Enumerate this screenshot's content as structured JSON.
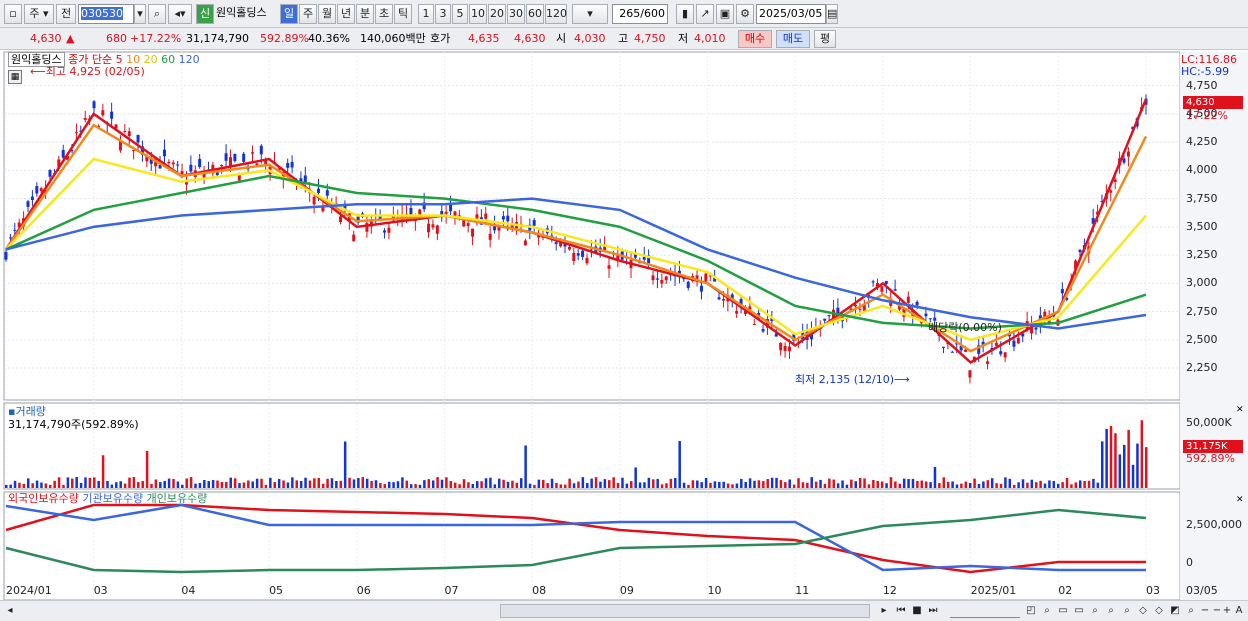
{
  "toolbar": {
    "market_label": "주",
    "prev_label": "전",
    "code_value": "030530",
    "badge_label": "신",
    "stock_name": "원익홀딩스",
    "periods": [
      "일",
      "주",
      "월",
      "년",
      "분",
      "초",
      "틱"
    ],
    "active_period": "일",
    "interval_numbers": [
      "1",
      "3",
      "5",
      "10",
      "20",
      "30",
      "60",
      "120"
    ],
    "count_value": "265",
    "count_total": "/600",
    "date_value": "2025/03/05"
  },
  "quote": {
    "price": "4,630",
    "change_arrow": "▲",
    "change": "680",
    "change_pct": "+17.22%",
    "volume": "31,174,790",
    "volume_ratio": "592.89%",
    "turnover_pct": "40.36%",
    "amount": "140,060백만",
    "bid_label": "호가",
    "bid_value": "4,635",
    "ask_value": "4,630",
    "open_label": "시",
    "open_value": "4,030",
    "high_label": "고",
    "high_value": "4,750",
    "low_label": "저",
    "low_value": "4,010",
    "buy_label": "매수",
    "sell_label": "매도",
    "eval_label": "평"
  },
  "legend": {
    "stock_label": "원익홀딩스",
    "ma_label": "종가 단순",
    "ma_periods": [
      "5",
      "10",
      "20",
      "60",
      "120"
    ],
    "ma_colors": [
      "#e0101c",
      "#f08a1c",
      "#f8e81c",
      "#20a040",
      "#3a66e0"
    ],
    "high_annotation": "최고 4,925 (02/05)",
    "low_annotation": "최저 2,135 (12/10)",
    "dividend_annotation": "배당락(0.00%)",
    "lc_label": "LC:116.86",
    "hc_label": "HC:-5.99",
    "price_tag": "4,630",
    "pct_tag": "17.22%"
  },
  "volume_panel": {
    "title": "거래량",
    "value_text": "31,174,790주(592.89%)",
    "axis_label": "50,000K",
    "tag_value": "31,175K",
    "tag_pct": "592.89%"
  },
  "holdings_panel": {
    "foreign_label": "외국인보유수량",
    "institution_label": "기관보유수량",
    "individual_label": "개인보유수량",
    "axis_labels": [
      "2,500,000",
      "0"
    ]
  },
  "x_axis": {
    "labels": [
      "2024/01",
      "03",
      "04",
      "05",
      "06",
      "07",
      "08",
      "09",
      "10",
      "11",
      "12",
      "2025/01",
      "02",
      "03",
      "03/05"
    ]
  },
  "chart_data": {
    "type": "line",
    "title": "원익홀딩스",
    "y_ticks": [
      "4,750",
      "4,500",
      "4,250",
      "4,000",
      "3,750",
      "3,500",
      "3,250",
      "3,000",
      "2,750",
      "2,500",
      "2,250"
    ],
    "ylim": [
      2100,
      4800
    ],
    "x": [
      "2024/01",
      "03",
      "04",
      "05",
      "06",
      "07",
      "08",
      "09",
      "10",
      "11",
      "12",
      "2025/01",
      "02",
      "03"
    ],
    "series": [
      {
        "name": "5",
        "values": [
          3300,
          4500,
          3950,
          4100,
          3500,
          3600,
          3450,
          3200,
          3000,
          2450,
          3000,
          2300,
          2750,
          4630
        ]
      },
      {
        "name": "10",
        "values": [
          3300,
          4400,
          3950,
          4050,
          3550,
          3600,
          3450,
          3250,
          3000,
          2500,
          2900,
          2400,
          2750,
          4300
        ]
      },
      {
        "name": "20",
        "values": [
          3300,
          4100,
          3900,
          4000,
          3600,
          3600,
          3500,
          3300,
          3100,
          2550,
          2800,
          2500,
          2700,
          3600
        ]
      },
      {
        "name": "60",
        "values": [
          3300,
          3650,
          3800,
          3950,
          3800,
          3750,
          3650,
          3500,
          3200,
          2800,
          2650,
          2600,
          2650,
          2900
        ]
      },
      {
        "name": "120",
        "values": [
          3300,
          3500,
          3600,
          3650,
          3700,
          3700,
          3750,
          3650,
          3300,
          3050,
          2850,
          2700,
          2600,
          2720
        ]
      }
    ],
    "events": [
      {
        "label": "최고 4,925 (02/05)",
        "value": 4925
      },
      {
        "label": "최저 2,135 (12/10)",
        "value": 2135
      }
    ]
  }
}
